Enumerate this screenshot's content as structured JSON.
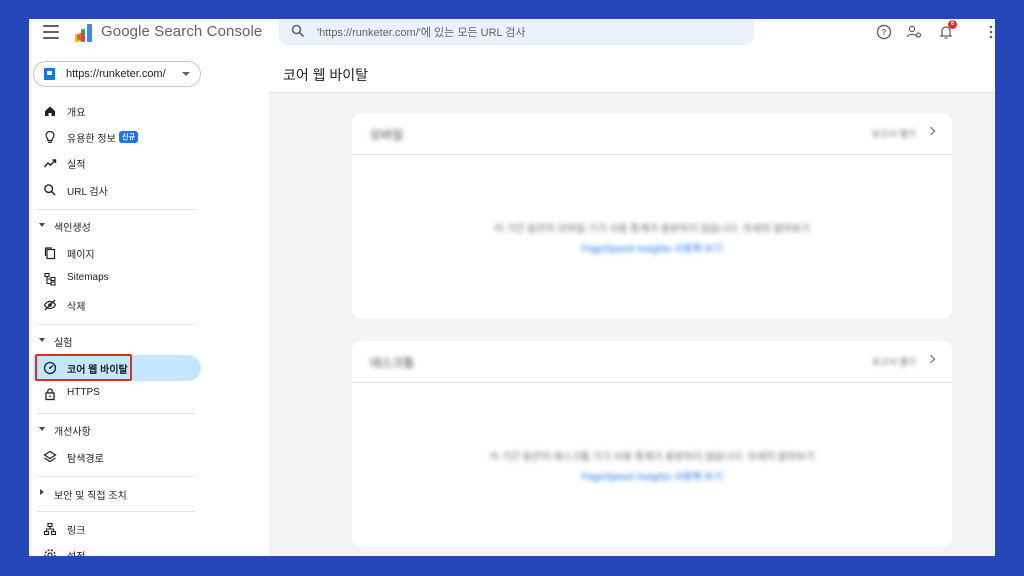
{
  "header": {
    "app_title": "Google Search Console",
    "search_placeholder": "'https://runketer.com/'에 있는 모든 URL 검사",
    "notification_count": "6"
  },
  "sidebar": {
    "property": "https://runketer.com/",
    "items": [
      {
        "label": "개요",
        "icon": "home-icon"
      },
      {
        "label": "유용한 정보",
        "icon": "lightbulb-icon",
        "badge": "신규"
      },
      {
        "label": "실적",
        "icon": "trending-up-icon"
      },
      {
        "label": "URL 검사",
        "icon": "search-icon"
      }
    ],
    "sections": {
      "indexing": {
        "title": "색인생성",
        "items": [
          {
            "label": "페이지",
            "icon": "pages-icon"
          },
          {
            "label": "Sitemaps",
            "icon": "sitemap-icon"
          },
          {
            "label": "삭제",
            "icon": "eye-off-icon"
          }
        ]
      },
      "experience": {
        "title": "실험",
        "items": [
          {
            "label": "코어 웹 바이탈",
            "icon": "gauge-icon",
            "active": true
          },
          {
            "label": "HTTPS",
            "icon": "lock-icon"
          }
        ]
      },
      "enhancements": {
        "title": "개선사항",
        "items": [
          {
            "label": "탐색경로",
            "icon": "layers-icon"
          }
        ]
      },
      "security": {
        "title": "보안 및 직접 조치"
      },
      "links": {
        "items": [
          {
            "label": "링크",
            "icon": "sitemap-tree-icon"
          },
          {
            "label": "설정",
            "icon": "settings-icon"
          }
        ]
      }
    }
  },
  "main": {
    "page_title": "코어 웹 바이탈",
    "cards": [
      {
        "title": "모바일",
        "report_link": "보고서 열기",
        "message": "이 기간 동안의 모바일 기기 사용 통계가 충분하지 않습니다. 자세히 알아보기",
        "link": "PageSpeed Insights 사용해 보기"
      },
      {
        "title": "데스크톱",
        "report_link": "보고서 열기",
        "message": "이 기간 동안의 데스크톱 기기 사용 통계가 충분하지 않습니다. 자세히 알아보기",
        "link": "PageSpeed Insights 사용해 보기"
      }
    ]
  },
  "colors": {
    "border_bg": "#2547b8",
    "accent": "#1a73e8",
    "active_bg": "#c2e7ff",
    "highlight": "#d93025"
  }
}
